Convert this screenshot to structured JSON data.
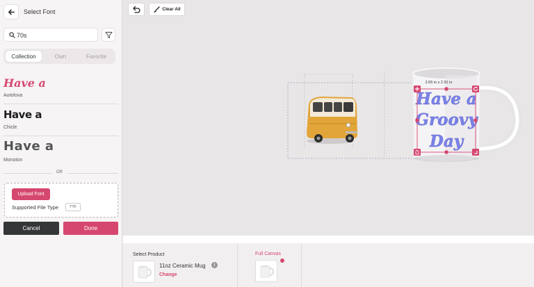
{
  "header": {
    "title": "Select Font"
  },
  "search": {
    "value": "70s"
  },
  "tabs": [
    {
      "label": "Collection",
      "active": true
    },
    {
      "label": "Own",
      "active": false
    },
    {
      "label": "Favorite",
      "active": false
    }
  ],
  "fonts": [
    {
      "sample": "Have a",
      "name": "Autolova"
    },
    {
      "sample": "Have a",
      "name": "Chicle"
    },
    {
      "sample": "Have a",
      "name": "Monoton"
    }
  ],
  "or_text": "OR",
  "upload": {
    "button": "Upload Font",
    "supported_label": "Supported File Type",
    "file_type": "TTF"
  },
  "actions": {
    "cancel": "Cancel",
    "done": "Done"
  },
  "toolbar": {
    "clear_all": "Clear All"
  },
  "canvas": {
    "dimensions": "2.65 in x 2.91 in",
    "design_text": [
      "Have a",
      "Groovy",
      "Day"
    ]
  },
  "product": {
    "select_label": "Select Product",
    "name": "11oz Ceramic Mug",
    "change": "Change",
    "full_canvas": "Full Canvas"
  },
  "colors": {
    "accent": "#d6476f",
    "design_text": "#7a82e8",
    "dark": "#343638"
  }
}
